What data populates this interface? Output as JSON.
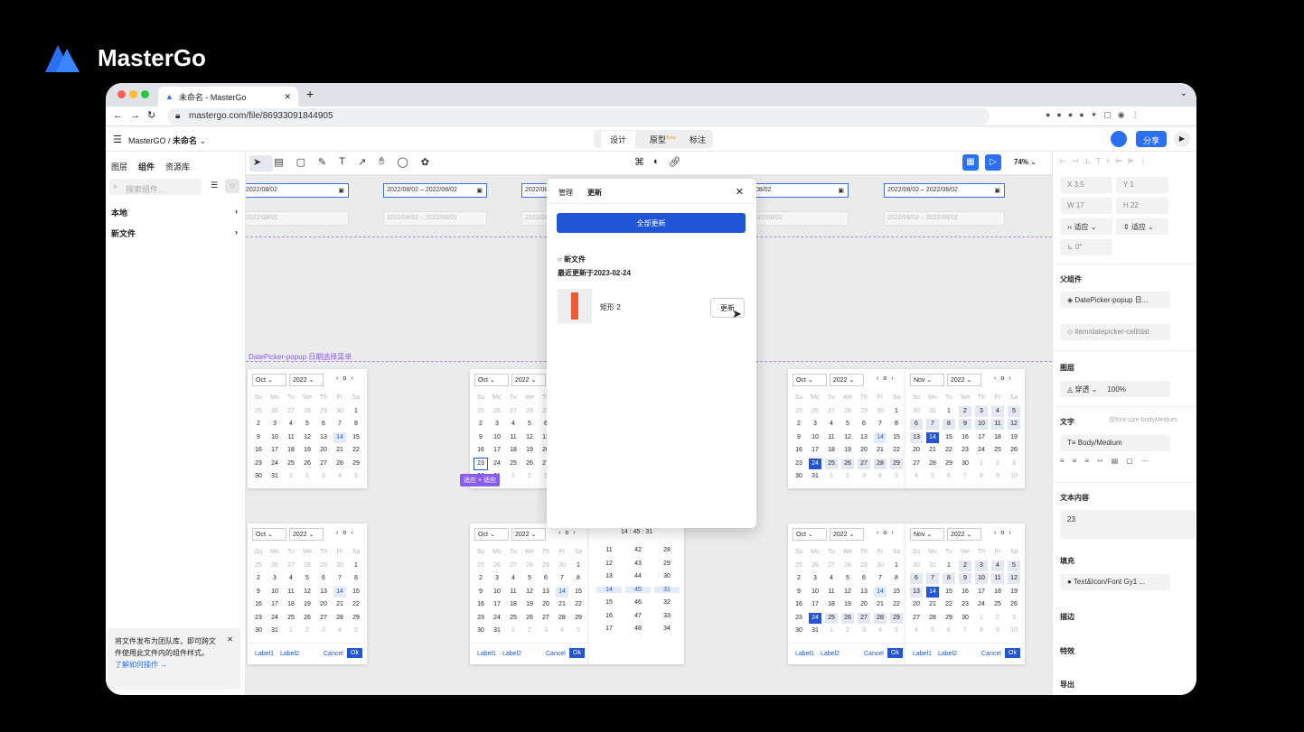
{
  "brand": {
    "name": "MasterGo"
  },
  "browser": {
    "tab_title": "未命名 - MasterGo",
    "url": "mastergo.com/file/86933091844905"
  },
  "app": {
    "breadcrumb_team": "MasterGO",
    "breadcrumb_file": "未命名",
    "mode_tabs": [
      "设计",
      "原型",
      "标注"
    ],
    "proto_badge": "Beta",
    "share": "分享",
    "zoom": "74%"
  },
  "left": {
    "tabs": [
      "图层",
      "组件",
      "资源库"
    ],
    "search": "搜索组件...",
    "sections": [
      "本地",
      "新文件"
    ],
    "notice": "将文件发布为团队库，即可跨文件使用此文件内的组件样式。",
    "notice_link": "了解如何操作 →"
  },
  "fields": {
    "single": "2022/08/02",
    "range_from": "2022/08/02",
    "range_sep": "–",
    "range_to": "2022/08/02",
    "partial": "08/02"
  },
  "canvas": {
    "frame_label": "DatePicker-popup 日期选择菜单",
    "tag": "适应 × 适应",
    "time_header": "14 : 45 : 31",
    "footer": {
      "label1": "Label1",
      "label2": "Label2",
      "cancel": "Cancel",
      "ok": "Ok"
    }
  },
  "calendar": {
    "month": "Oct",
    "month2": "Nov",
    "year": "2022",
    "weekdays": [
      "Su",
      "Mo",
      "Tu",
      "We",
      "Th",
      "Fr",
      "Sa"
    ],
    "oct": [
      "25",
      "26",
      "27",
      "28",
      "29",
      "30",
      "1",
      "2",
      "3",
      "4",
      "5",
      "6",
      "7",
      "8",
      "9",
      "10",
      "11",
      "12",
      "13",
      "14",
      "15",
      "16",
      "17",
      "18",
      "19",
      "20",
      "21",
      "22",
      "23",
      "24",
      "25",
      "26",
      "27",
      "28",
      "29",
      "30",
      "31",
      "1",
      "2",
      "3",
      "4",
      "5"
    ],
    "nov": [
      "30",
      "31",
      "1",
      "2",
      "3",
      "4",
      "5",
      "6",
      "7",
      "8",
      "9",
      "10",
      "11",
      "12",
      "13",
      "14",
      "15",
      "16",
      "17",
      "18",
      "19",
      "20",
      "21",
      "22",
      "23",
      "24",
      "25",
      "26",
      "27",
      "28",
      "29",
      "30",
      "1",
      "2",
      "3",
      "4",
      "5",
      "6",
      "7",
      "8",
      "9",
      "10"
    ],
    "time_cols": [
      [
        "11",
        "12",
        "13",
        "14",
        "15",
        "16",
        "17"
      ],
      [
        "42",
        "43",
        "44",
        "45",
        "46",
        "47",
        "48"
      ],
      [
        "28",
        "29",
        "30",
        "31",
        "32",
        "33",
        "34"
      ]
    ]
  },
  "popup": {
    "tabs": [
      "管理",
      "更新"
    ],
    "update_all": "全部更新",
    "file_name": "新文件",
    "last_update": "最近更新于2023-02-24",
    "component_name": "矩形 2",
    "update": "更新"
  },
  "right": {
    "x": "3.5",
    "y": "1",
    "w": "17",
    "h": "22",
    "fit1": "适应",
    "fit2": "适应",
    "rot": "0°",
    "parent_title": "父组件",
    "parent": "DatePicker-popup 日...",
    "parent2": "item/datepicker-cell/dat",
    "layer_title": "图层",
    "blend": "穿透",
    "opacity": "100%",
    "text_title": "文字",
    "text_token": "@font-size-bodyMedium",
    "text_style": "Body/Medium",
    "content_title": "文本内容",
    "content": "23",
    "fill_title": "填充",
    "fill": "Text&Icon/Font Gy1 ...",
    "stroke": "描边",
    "effect": "特效",
    "export": "导出"
  },
  "colors": {
    "accent": "#2055d5",
    "brand": "#2b6ff2",
    "orange": "#f05a32"
  }
}
